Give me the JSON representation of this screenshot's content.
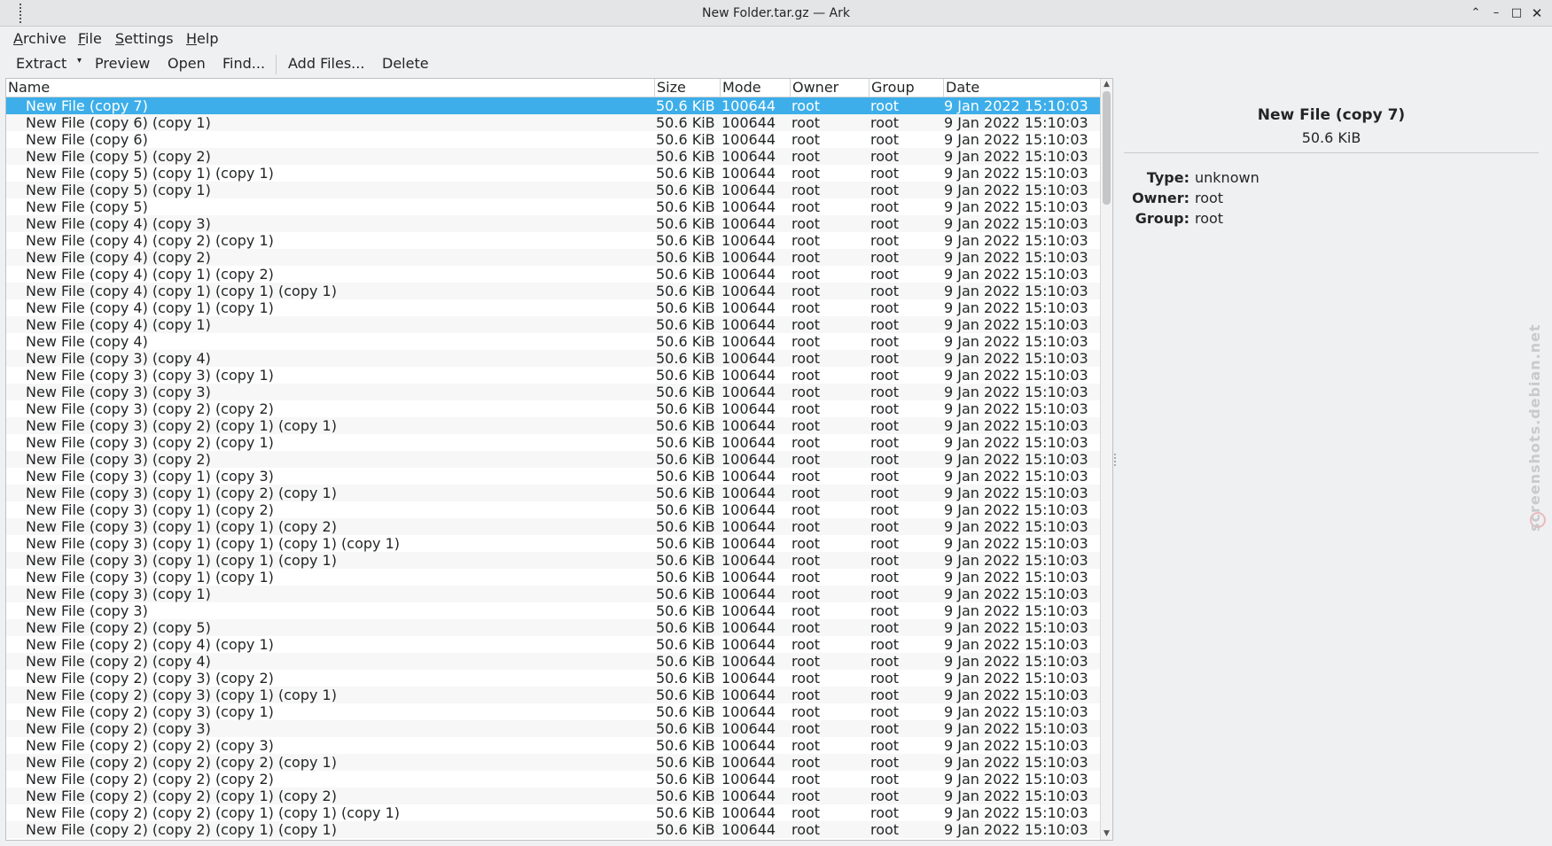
{
  "window": {
    "title": "New Folder.tar.gz — Ark",
    "controls": {
      "shade_icon": "chevron-up-icon",
      "minimize_icon": "minimize-icon",
      "maximize_icon": "maximize-icon",
      "close_icon": "close-icon"
    }
  },
  "menubar": {
    "archive": {
      "mnemonic": "A",
      "rest": "rchive"
    },
    "file": {
      "mnemonic": "F",
      "rest": "ile"
    },
    "settings": {
      "mnemonic": "S",
      "rest": "ettings"
    },
    "help": {
      "mnemonic": "H",
      "rest": "elp"
    }
  },
  "toolbar": {
    "extract": "Extract",
    "preview": "Preview",
    "open": "Open",
    "find": "Find...",
    "add_files": "Add Files...",
    "delete": "Delete"
  },
  "columns": {
    "name": "Name",
    "size": "Size",
    "mode": "Mode",
    "owner": "Owner",
    "group": "Group",
    "date": "Date"
  },
  "files": [
    {
      "name": "New File (copy 7)",
      "size": "50.6 KiB",
      "mode": "100644",
      "owner": "root",
      "group": "root",
      "date": "9 Jan 2022 15:10:03",
      "selected": true
    },
    {
      "name": "New File (copy 6) (copy 1)",
      "size": "50.6 KiB",
      "mode": "100644",
      "owner": "root",
      "group": "root",
      "date": "9 Jan 2022 15:10:03"
    },
    {
      "name": "New File (copy 6)",
      "size": "50.6 KiB",
      "mode": "100644",
      "owner": "root",
      "group": "root",
      "date": "9 Jan 2022 15:10:03"
    },
    {
      "name": "New File (copy 5) (copy 2)",
      "size": "50.6 KiB",
      "mode": "100644",
      "owner": "root",
      "group": "root",
      "date": "9 Jan 2022 15:10:03"
    },
    {
      "name": "New File (copy 5) (copy 1) (copy 1)",
      "size": "50.6 KiB",
      "mode": "100644",
      "owner": "root",
      "group": "root",
      "date": "9 Jan 2022 15:10:03"
    },
    {
      "name": "New File (copy 5) (copy 1)",
      "size": "50.6 KiB",
      "mode": "100644",
      "owner": "root",
      "group": "root",
      "date": "9 Jan 2022 15:10:03"
    },
    {
      "name": "New File (copy 5)",
      "size": "50.6 KiB",
      "mode": "100644",
      "owner": "root",
      "group": "root",
      "date": "9 Jan 2022 15:10:03"
    },
    {
      "name": "New File (copy 4) (copy 3)",
      "size": "50.6 KiB",
      "mode": "100644",
      "owner": "root",
      "group": "root",
      "date": "9 Jan 2022 15:10:03"
    },
    {
      "name": "New File (copy 4) (copy 2) (copy 1)",
      "size": "50.6 KiB",
      "mode": "100644",
      "owner": "root",
      "group": "root",
      "date": "9 Jan 2022 15:10:03"
    },
    {
      "name": "New File (copy 4) (copy 2)",
      "size": "50.6 KiB",
      "mode": "100644",
      "owner": "root",
      "group": "root",
      "date": "9 Jan 2022 15:10:03"
    },
    {
      "name": "New File (copy 4) (copy 1) (copy 2)",
      "size": "50.6 KiB",
      "mode": "100644",
      "owner": "root",
      "group": "root",
      "date": "9 Jan 2022 15:10:03"
    },
    {
      "name": "New File (copy 4) (copy 1) (copy 1) (copy 1)",
      "size": "50.6 KiB",
      "mode": "100644",
      "owner": "root",
      "group": "root",
      "date": "9 Jan 2022 15:10:03"
    },
    {
      "name": "New File (copy 4) (copy 1) (copy 1)",
      "size": "50.6 KiB",
      "mode": "100644",
      "owner": "root",
      "group": "root",
      "date": "9 Jan 2022 15:10:03"
    },
    {
      "name": "New File (copy 4) (copy 1)",
      "size": "50.6 KiB",
      "mode": "100644",
      "owner": "root",
      "group": "root",
      "date": "9 Jan 2022 15:10:03"
    },
    {
      "name": "New File (copy 4)",
      "size": "50.6 KiB",
      "mode": "100644",
      "owner": "root",
      "group": "root",
      "date": "9 Jan 2022 15:10:03"
    },
    {
      "name": "New File (copy 3) (copy 4)",
      "size": "50.6 KiB",
      "mode": "100644",
      "owner": "root",
      "group": "root",
      "date": "9 Jan 2022 15:10:03"
    },
    {
      "name": "New File (copy 3) (copy 3) (copy 1)",
      "size": "50.6 KiB",
      "mode": "100644",
      "owner": "root",
      "group": "root",
      "date": "9 Jan 2022 15:10:03"
    },
    {
      "name": "New File (copy 3) (copy 3)",
      "size": "50.6 KiB",
      "mode": "100644",
      "owner": "root",
      "group": "root",
      "date": "9 Jan 2022 15:10:03"
    },
    {
      "name": "New File (copy 3) (copy 2) (copy 2)",
      "size": "50.6 KiB",
      "mode": "100644",
      "owner": "root",
      "group": "root",
      "date": "9 Jan 2022 15:10:03"
    },
    {
      "name": "New File (copy 3) (copy 2) (copy 1) (copy 1)",
      "size": "50.6 KiB",
      "mode": "100644",
      "owner": "root",
      "group": "root",
      "date": "9 Jan 2022 15:10:03"
    },
    {
      "name": "New File (copy 3) (copy 2) (copy 1)",
      "size": "50.6 KiB",
      "mode": "100644",
      "owner": "root",
      "group": "root",
      "date": "9 Jan 2022 15:10:03"
    },
    {
      "name": "New File (copy 3) (copy 2)",
      "size": "50.6 KiB",
      "mode": "100644",
      "owner": "root",
      "group": "root",
      "date": "9 Jan 2022 15:10:03"
    },
    {
      "name": "New File (copy 3) (copy 1) (copy 3)",
      "size": "50.6 KiB",
      "mode": "100644",
      "owner": "root",
      "group": "root",
      "date": "9 Jan 2022 15:10:03"
    },
    {
      "name": "New File (copy 3) (copy 1) (copy 2) (copy 1)",
      "size": "50.6 KiB",
      "mode": "100644",
      "owner": "root",
      "group": "root",
      "date": "9 Jan 2022 15:10:03"
    },
    {
      "name": "New File (copy 3) (copy 1) (copy 2)",
      "size": "50.6 KiB",
      "mode": "100644",
      "owner": "root",
      "group": "root",
      "date": "9 Jan 2022 15:10:03"
    },
    {
      "name": "New File (copy 3) (copy 1) (copy 1) (copy 2)",
      "size": "50.6 KiB",
      "mode": "100644",
      "owner": "root",
      "group": "root",
      "date": "9 Jan 2022 15:10:03"
    },
    {
      "name": "New File (copy 3) (copy 1) (copy 1) (copy 1) (copy 1)",
      "size": "50.6 KiB",
      "mode": "100644",
      "owner": "root",
      "group": "root",
      "date": "9 Jan 2022 15:10:03"
    },
    {
      "name": "New File (copy 3) (copy 1) (copy 1) (copy 1)",
      "size": "50.6 KiB",
      "mode": "100644",
      "owner": "root",
      "group": "root",
      "date": "9 Jan 2022 15:10:03"
    },
    {
      "name": "New File (copy 3) (copy 1) (copy 1)",
      "size": "50.6 KiB",
      "mode": "100644",
      "owner": "root",
      "group": "root",
      "date": "9 Jan 2022 15:10:03"
    },
    {
      "name": "New File (copy 3) (copy 1)",
      "size": "50.6 KiB",
      "mode": "100644",
      "owner": "root",
      "group": "root",
      "date": "9 Jan 2022 15:10:03"
    },
    {
      "name": "New File (copy 3)",
      "size": "50.6 KiB",
      "mode": "100644",
      "owner": "root",
      "group": "root",
      "date": "9 Jan 2022 15:10:03"
    },
    {
      "name": "New File (copy 2) (copy 5)",
      "size": "50.6 KiB",
      "mode": "100644",
      "owner": "root",
      "group": "root",
      "date": "9 Jan 2022 15:10:03"
    },
    {
      "name": "New File (copy 2) (copy 4) (copy 1)",
      "size": "50.6 KiB",
      "mode": "100644",
      "owner": "root",
      "group": "root",
      "date": "9 Jan 2022 15:10:03"
    },
    {
      "name": "New File (copy 2) (copy 4)",
      "size": "50.6 KiB",
      "mode": "100644",
      "owner": "root",
      "group": "root",
      "date": "9 Jan 2022 15:10:03"
    },
    {
      "name": "New File (copy 2) (copy 3) (copy 2)",
      "size": "50.6 KiB",
      "mode": "100644",
      "owner": "root",
      "group": "root",
      "date": "9 Jan 2022 15:10:03"
    },
    {
      "name": "New File (copy 2) (copy 3) (copy 1) (copy 1)",
      "size": "50.6 KiB",
      "mode": "100644",
      "owner": "root",
      "group": "root",
      "date": "9 Jan 2022 15:10:03"
    },
    {
      "name": "New File (copy 2) (copy 3) (copy 1)",
      "size": "50.6 KiB",
      "mode": "100644",
      "owner": "root",
      "group": "root",
      "date": "9 Jan 2022 15:10:03"
    },
    {
      "name": "New File (copy 2) (copy 3)",
      "size": "50.6 KiB",
      "mode": "100644",
      "owner": "root",
      "group": "root",
      "date": "9 Jan 2022 15:10:03"
    },
    {
      "name": "New File (copy 2) (copy 2) (copy 3)",
      "size": "50.6 KiB",
      "mode": "100644",
      "owner": "root",
      "group": "root",
      "date": "9 Jan 2022 15:10:03"
    },
    {
      "name": "New File (copy 2) (copy 2) (copy 2) (copy 1)",
      "size": "50.6 KiB",
      "mode": "100644",
      "owner": "root",
      "group": "root",
      "date": "9 Jan 2022 15:10:03"
    },
    {
      "name": "New File (copy 2) (copy 2) (copy 2)",
      "size": "50.6 KiB",
      "mode": "100644",
      "owner": "root",
      "group": "root",
      "date": "9 Jan 2022 15:10:03"
    },
    {
      "name": "New File (copy 2) (copy 2) (copy 1) (copy 2)",
      "size": "50.6 KiB",
      "mode": "100644",
      "owner": "root",
      "group": "root",
      "date": "9 Jan 2022 15:10:03"
    },
    {
      "name": "New File (copy 2) (copy 2) (copy 1) (copy 1) (copy 1)",
      "size": "50.6 KiB",
      "mode": "100644",
      "owner": "root",
      "group": "root",
      "date": "9 Jan 2022 15:10:03"
    },
    {
      "name": "New File (copy 2) (copy 2) (copy 1) (copy 1)",
      "size": "50.6 KiB",
      "mode": "100644",
      "owner": "root",
      "group": "root",
      "date": "9 Jan 2022 15:10:03"
    }
  ],
  "details": {
    "name": "New File (copy 7)",
    "size": "50.6 KiB",
    "type_label": "Type:",
    "type_value": "unknown",
    "owner_label": "Owner:",
    "owner_value": "root",
    "group_label": "Group:",
    "group_value": "root"
  },
  "watermark": "screenshots.debian.net",
  "colors": {
    "selection": "#3daee9",
    "background": "#eff0f1",
    "list_bg": "#ffffff"
  }
}
